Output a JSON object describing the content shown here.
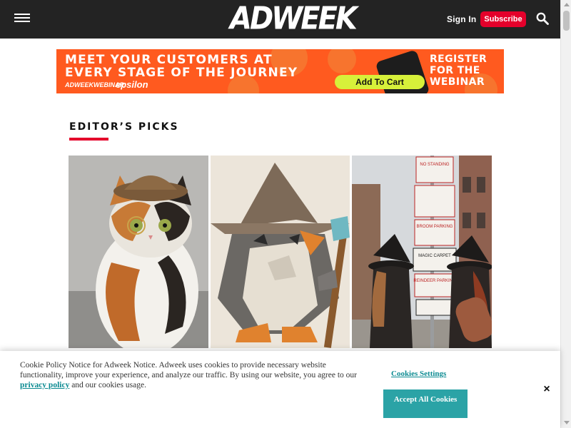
{
  "header": {
    "logo": "ADWEEK",
    "signin_label": "Sign In",
    "subscribe_label": "Subscribe"
  },
  "ad": {
    "headline": "MEET YOUR CUSTOMERS AT EVERY STAGE OF THE JOURNEY",
    "brand_primary": "ADWEEKWEBINAR",
    "brand_partner": "epsilon",
    "cta_label": "Add To Cart",
    "register_text": "REGISTER FOR THE WEBINAR",
    "color": "#ff5a1f"
  },
  "editors_picks": {
    "title": "EDITOR’S PICKS",
    "accent_color": "#e4002b",
    "street_sign_lines": [
      "NO STANDING",
      "BROOM PARKING",
      "MAGIC CARPET",
      "REINDEER PARKING"
    ]
  },
  "cookie": {
    "text_before": "Cookie Policy Notice for Adweek Notice. Adweek uses cookies to provide necessary website functionality, improve your experience, and analyze our traffic. By using our website, you agree to our",
    "link_text": "privacy policy",
    "text_after": "and our cookies usage.",
    "settings_label": "Cookies Settings",
    "accept_label": "Accept All Cookies",
    "close_label": "×",
    "accent_color": "#2ba3a6"
  }
}
